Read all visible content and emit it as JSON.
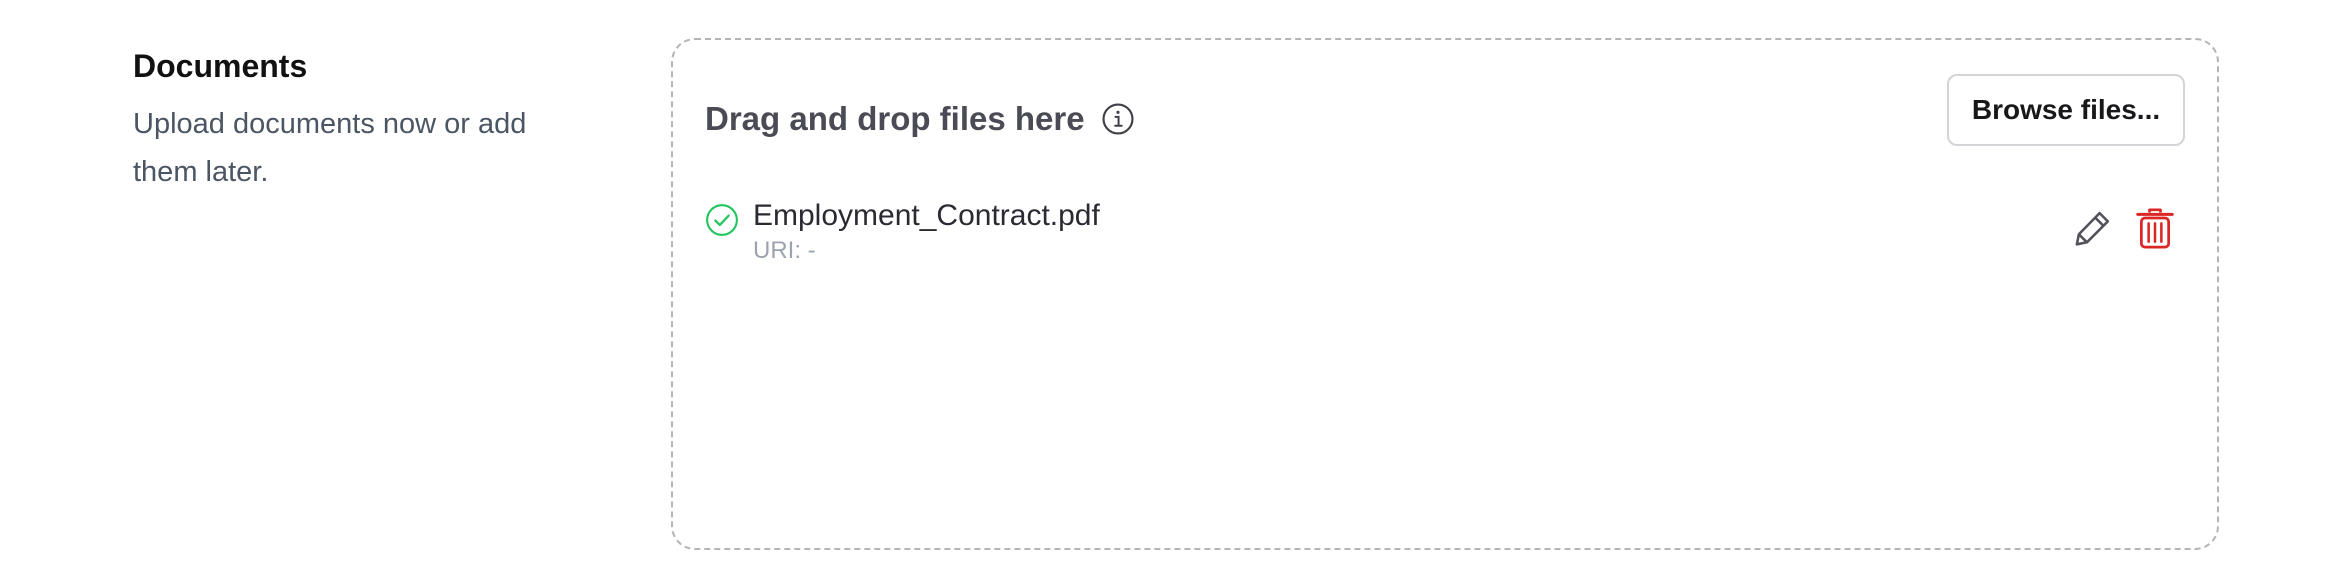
{
  "section": {
    "title": "Documents",
    "description": "Upload documents now or add them later."
  },
  "dropzone": {
    "title": "Drag and drop files here",
    "browse_label": "Browse files..."
  },
  "files": [
    {
      "name": "Employment_Contract.pdf",
      "uri": "URI: -",
      "status": "uploaded"
    }
  ],
  "colors": {
    "success": "#22c55e",
    "danger": "#dc2626",
    "muted": "#9ca3af",
    "border": "#b5b5b5"
  },
  "icons": {
    "info": "info-icon",
    "status": "check-circle-icon",
    "edit": "pencil-icon",
    "delete": "trash-icon"
  }
}
